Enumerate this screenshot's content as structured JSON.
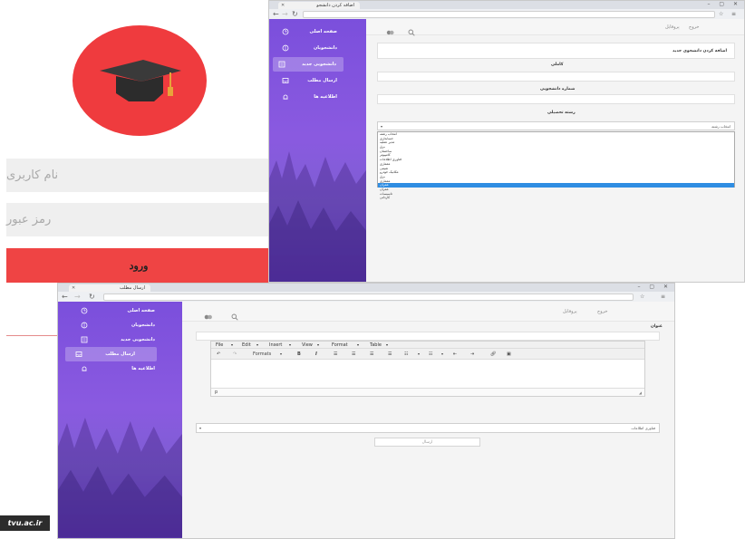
{
  "login": {
    "username_placeholder": "نام کاربری",
    "password_placeholder": "رمز عبور",
    "login_button": "ورود",
    "colors": {
      "accent": "#ef4444",
      "logo_bg": "#ef3b3e"
    }
  },
  "sidebar": {
    "items": [
      {
        "label": "صفحه اصلی",
        "icon": "clock-icon"
      },
      {
        "label": "دانشجویان",
        "icon": "group-icon"
      },
      {
        "label": "دانشجویی جدید",
        "icon": "clipboard-icon"
      },
      {
        "label": "ارسال مطلب",
        "icon": "inbox-icon"
      },
      {
        "label": "اطلاعیه ها",
        "icon": "bell-icon"
      }
    ]
  },
  "window1": {
    "tab_title": "اضافه کردن دانشجو",
    "topbar": {
      "link1": "خروج",
      "link2": "پروفایل"
    },
    "form": {
      "card_title": "اضافه کردن دانشجوی جدید",
      "label_name": "کاملی",
      "label_student_id": "شماره دانشجویی",
      "label_field": "رشته تحصیلی",
      "select_value": "انتخاب رشته",
      "options": [
        "انتخاب رشته",
        "حسابداری",
        "مدیر عملیه",
        "برق",
        "ساختمان",
        "کامپیوتر",
        "فناوری اطلاعات",
        "معماری",
        "شیمی",
        "مکانیک خودرو",
        "برق",
        "معماری",
        "عمران",
        "عمران",
        "تاسیسات",
        "کاردانی"
      ],
      "selected_option_index": 12
    }
  },
  "window2": {
    "tab_title": "ارسال مطلب",
    "topbar": {
      "link1": "خروج",
      "link2": "پروفایل"
    },
    "title_label": "عنوان",
    "editor": {
      "menus": [
        "File",
        "Edit",
        "Insert",
        "View",
        "Format",
        "Table"
      ],
      "formats_label": "Formats",
      "status_path": "p"
    },
    "category_select": "فناوری اطلاعات",
    "send_button": "ارسال"
  },
  "watermark": "tvu.ac.ir"
}
